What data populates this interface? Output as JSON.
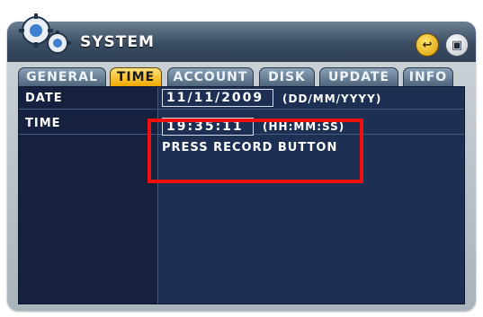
{
  "window": {
    "title": "SYSTEM"
  },
  "titlebar_buttons": {
    "back_icon": "enter-return-icon",
    "close_icon": "close-icon"
  },
  "tabs": [
    {
      "label": "GENERAL",
      "active": false
    },
    {
      "label": "TIME",
      "active": true
    },
    {
      "label": "ACCOUNT",
      "active": false
    },
    {
      "label": "DISK",
      "active": false
    },
    {
      "label": "UPDATE",
      "active": false
    },
    {
      "label": "INFO",
      "active": false
    }
  ],
  "fields": {
    "date": {
      "label": "DATE",
      "value": "11/11/2009",
      "format": "(DD/MM/YYYY)"
    },
    "time": {
      "label": "TIME",
      "value": "19:35:11",
      "format": "(HH:MM:SS)"
    }
  },
  "message": "PRESS RECORD BUTTON",
  "colors": {
    "accent_tab": "#f0a900",
    "panel_bg": "#1d2f52",
    "highlight": "#f01010"
  }
}
